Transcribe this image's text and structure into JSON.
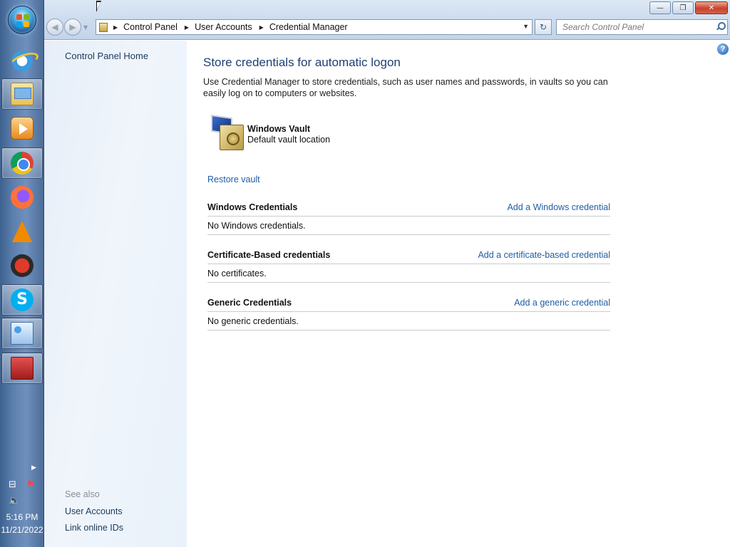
{
  "taskbar": {
    "items": [
      {
        "name": "internet-explorer",
        "icon": "ie-icon"
      },
      {
        "name": "windows-explorer",
        "icon": "folder-icon"
      },
      {
        "name": "media-player",
        "icon": "media-player-icon"
      },
      {
        "name": "chrome",
        "icon": "chrome-icon"
      },
      {
        "name": "firefox",
        "icon": "firefox-icon"
      },
      {
        "name": "vlc",
        "icon": "vlc-cone-icon"
      },
      {
        "name": "utility",
        "icon": "red-gear-icon"
      },
      {
        "name": "skype",
        "icon": "skype-icon",
        "glyph": "S"
      },
      {
        "name": "control-panel",
        "icon": "control-panel-icon"
      },
      {
        "name": "toolbox",
        "icon": "toolbox-icon"
      }
    ],
    "clock": {
      "time": "5:16 PM",
      "date": "11/21/2022"
    }
  },
  "window": {
    "controls": {
      "minimize": "—",
      "maximize": "❐",
      "close": "✕"
    },
    "breadcrumb": [
      "Control Panel",
      "User Accounts",
      "Credential Manager"
    ],
    "search_placeholder": "Search Control Panel",
    "sidebar": {
      "home": "Control Panel Home",
      "see_also": "See also",
      "links": [
        "User Accounts",
        "Link online IDs"
      ]
    },
    "content": {
      "title": "Store credentials for automatic logon",
      "description": "Use Credential Manager to store credentials, such as user names and passwords, in vaults so you can easily log on to computers or websites.",
      "vault": {
        "name": "Windows Vault",
        "location": "Default vault location"
      },
      "restore_link": "Restore vault",
      "sections": [
        {
          "title": "Windows Credentials",
          "action": "Add a Windows credential",
          "empty": "No Windows credentials."
        },
        {
          "title": "Certificate-Based credentials",
          "action": "Add a certificate-based credential",
          "empty": "No certificates."
        },
        {
          "title": "Generic Credentials",
          "action": "Add a generic credential",
          "empty": "No generic credentials."
        }
      ]
    }
  },
  "colors": {
    "link": "#1e5ea8",
    "title": "#1e3f73",
    "taskbar": "#5c7fad"
  }
}
